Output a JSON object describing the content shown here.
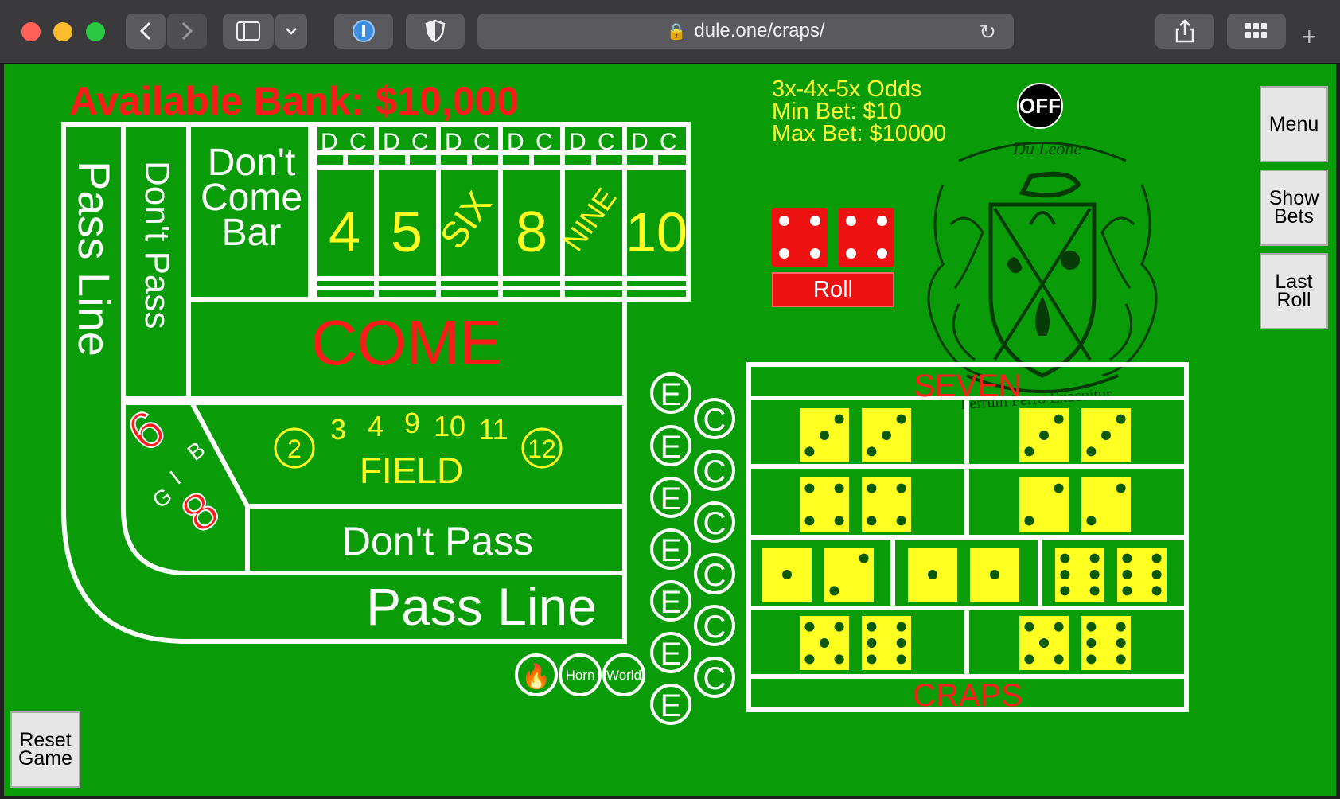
{
  "browser": {
    "url": "dule.one/craps/"
  },
  "header": {
    "bank_label": "Available Bank: $10,000",
    "odds_line1": "3x-4x-5x Odds",
    "odds_line2": "Min Bet: $10",
    "odds_line3": "Max Bet: $10000",
    "puck": "OFF"
  },
  "buttons": {
    "menu": "Menu",
    "show_bets_1": "Show",
    "show_bets_2": "Bets",
    "last_roll_1": "Last",
    "last_roll_2": "Roll",
    "reset_1": "Reset",
    "reset_2": "Game",
    "roll": "Roll"
  },
  "dice": {
    "die1": 4,
    "die2": 4
  },
  "board": {
    "pass_line_vertical": "Pass Line",
    "dont_pass_vertical": "Don't Pass",
    "dont_come_bar_1": "Don't",
    "dont_come_bar_2": "Come",
    "dont_come_bar_3": "Bar",
    "dc_d": "D",
    "dc_c": "C",
    "numbers": [
      "4",
      "5",
      "SIX",
      "8",
      "NINE",
      "10"
    ],
    "come": "COME",
    "field": "FIELD",
    "field_numbers": [
      "2",
      "3",
      "4",
      "9",
      "10",
      "11",
      "12"
    ],
    "big_6": "6",
    "big_8": "8",
    "big_b": "B",
    "big_i": "I",
    "big_g": "G",
    "dont_pass_bottom": "Don't Pass",
    "pass_line_bottom": "Pass Line"
  },
  "props": {
    "seven": "SEVEN",
    "craps": "CRAPS",
    "e": "E",
    "c": "C",
    "horn": "Horn",
    "world": "World",
    "fire": "🔥"
  },
  "crest": {
    "motto": "Ferrum Ferro Exacuitur",
    "name": "Du Leone"
  }
}
